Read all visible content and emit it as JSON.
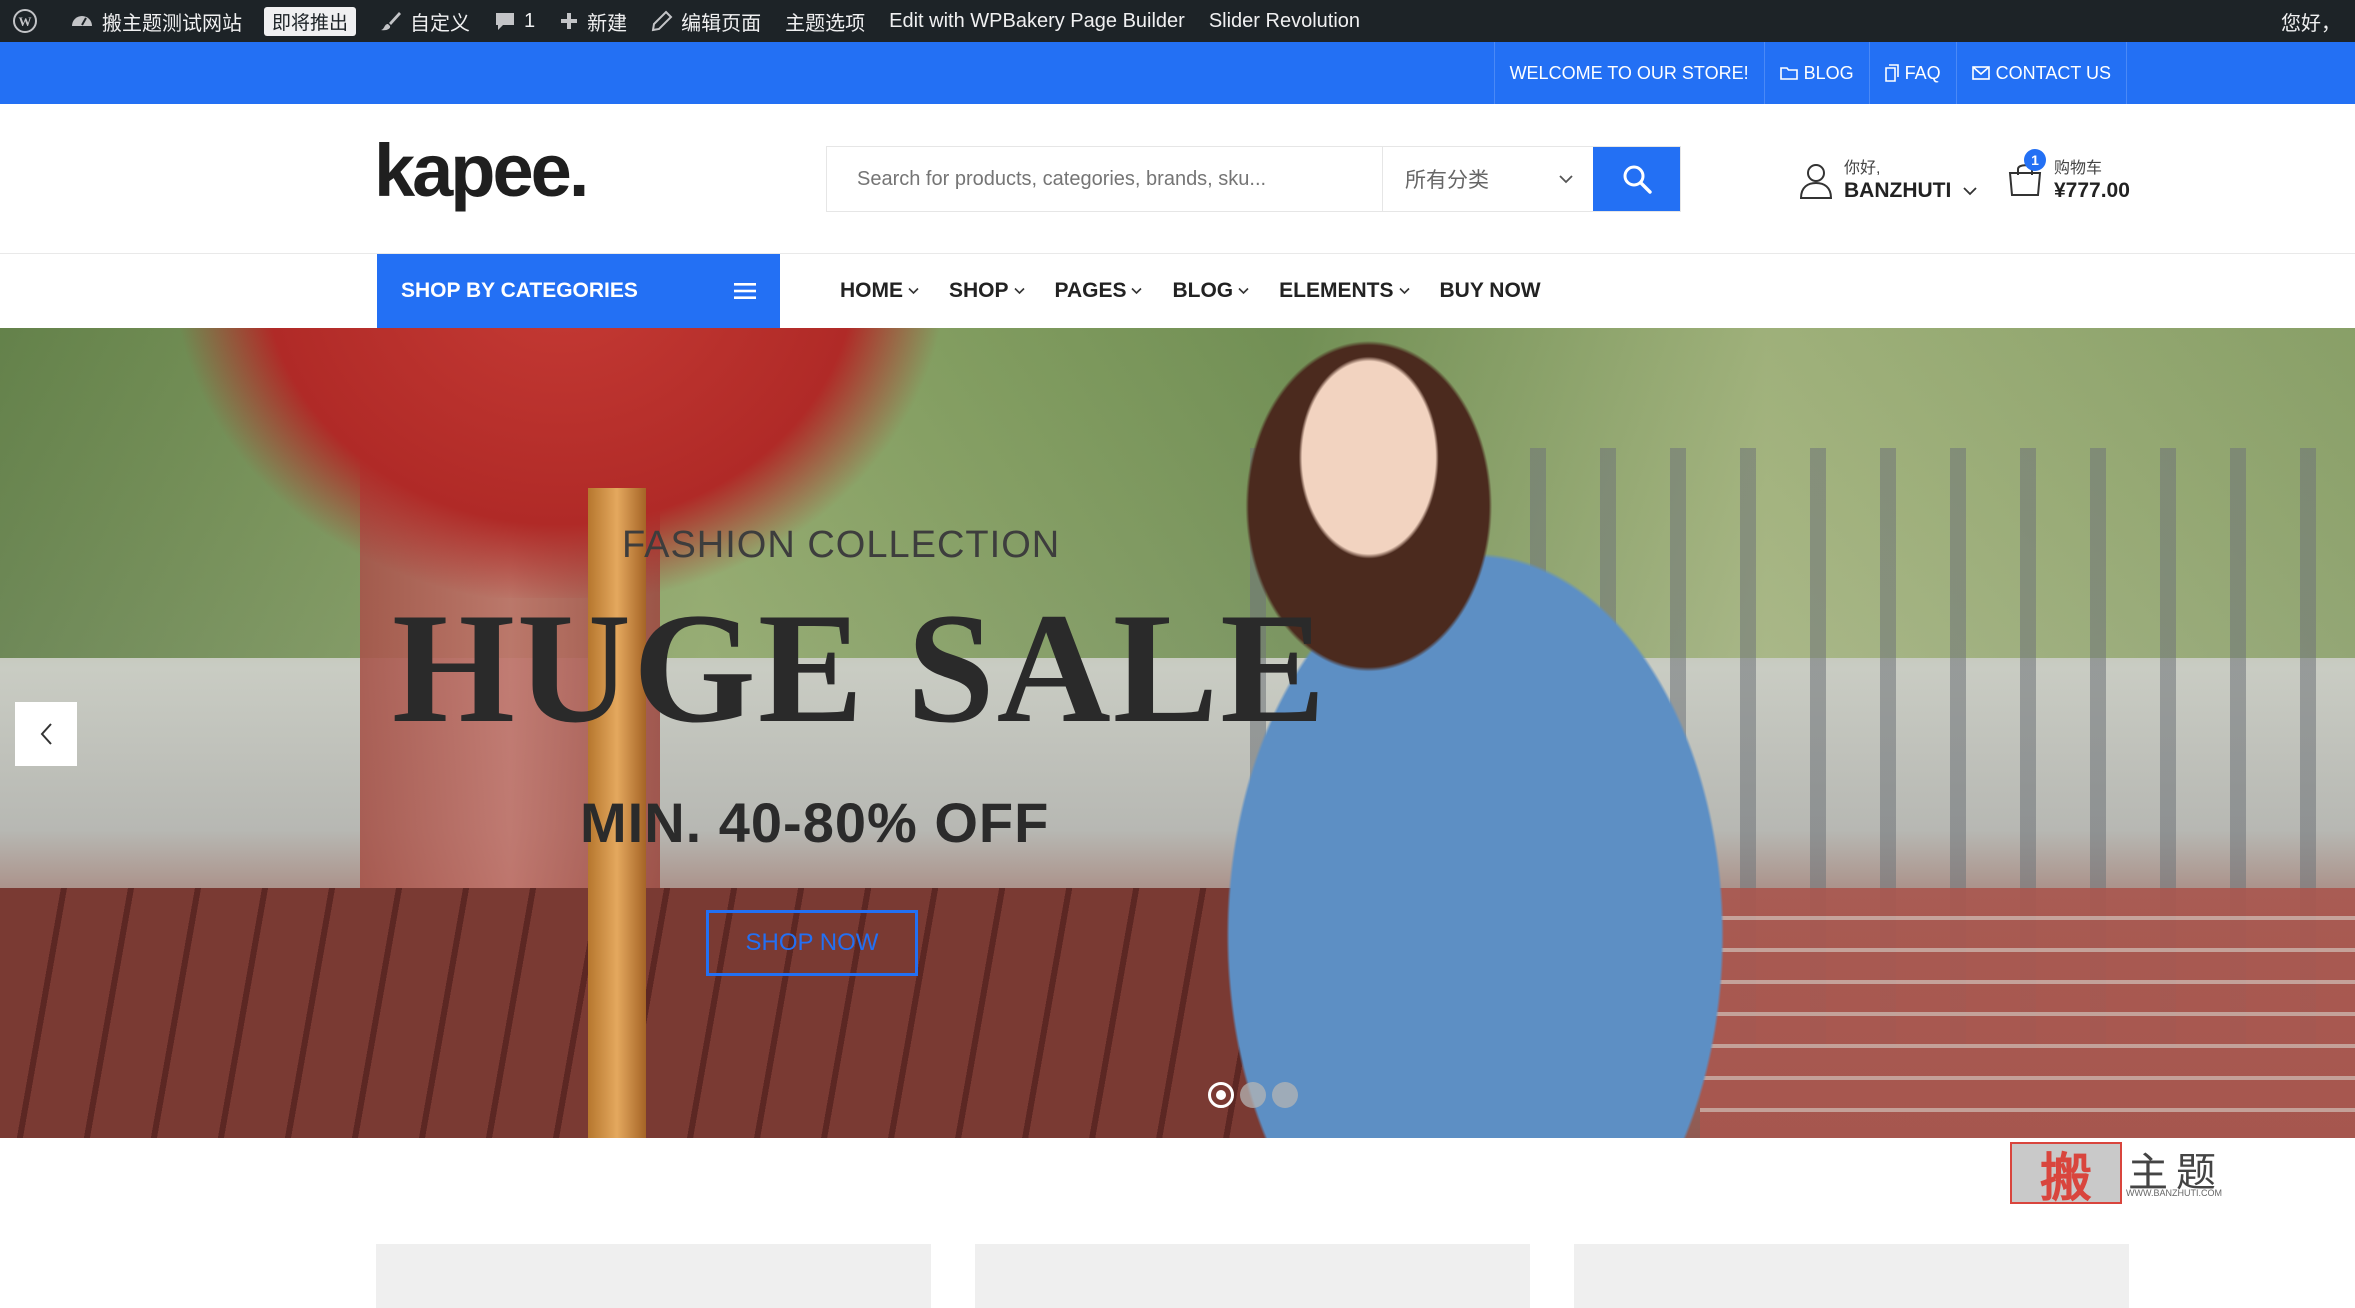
{
  "adminbar": {
    "site_name": "搬主题测试网站",
    "badge": "即将推出",
    "customize": "自定义",
    "comments_count": "1",
    "new": "新建",
    "edit_page": "编辑页面",
    "theme_options": "主题选项",
    "wpbakery": "Edit with WPBakery Page Builder",
    "slider": "Slider Revolution",
    "greeting": "您好，"
  },
  "topbar": {
    "welcome": "WELCOME TO OUR STORE!",
    "blog": "BLOG",
    "faq": "FAQ",
    "contact": "CONTACT US"
  },
  "header": {
    "logo": "kapee.",
    "search_placeholder": "Search for products, categories, brands, sku...",
    "category_select": "所有分类",
    "account_greeting": "你好,",
    "account_name": "BANZHUTI",
    "cart_count": "1",
    "cart_label": "购物车",
    "cart_total": "¥777.00"
  },
  "nav": {
    "categories_label": "SHOP BY CATEGORIES",
    "items": [
      {
        "label": "HOME",
        "dropdown": true
      },
      {
        "label": "SHOP",
        "dropdown": true
      },
      {
        "label": "PAGES",
        "dropdown": true
      },
      {
        "label": "BLOG",
        "dropdown": true
      },
      {
        "label": "ELEMENTS",
        "dropdown": true
      },
      {
        "label": "BUY NOW",
        "dropdown": false
      }
    ]
  },
  "hero": {
    "eyebrow": "FASHION COLLECTION",
    "title": "HUGE SALE",
    "subtitle": "MIN. 40-80% OFF",
    "cta": "SHOP NOW",
    "slides": 3,
    "active_slide": 1
  },
  "watermark": {
    "seal": "搬",
    "text": "主题",
    "url": "WWW.BANZHUTI.COM"
  },
  "colors": {
    "accent": "#2370f4",
    "adminbar": "#1d2327"
  }
}
